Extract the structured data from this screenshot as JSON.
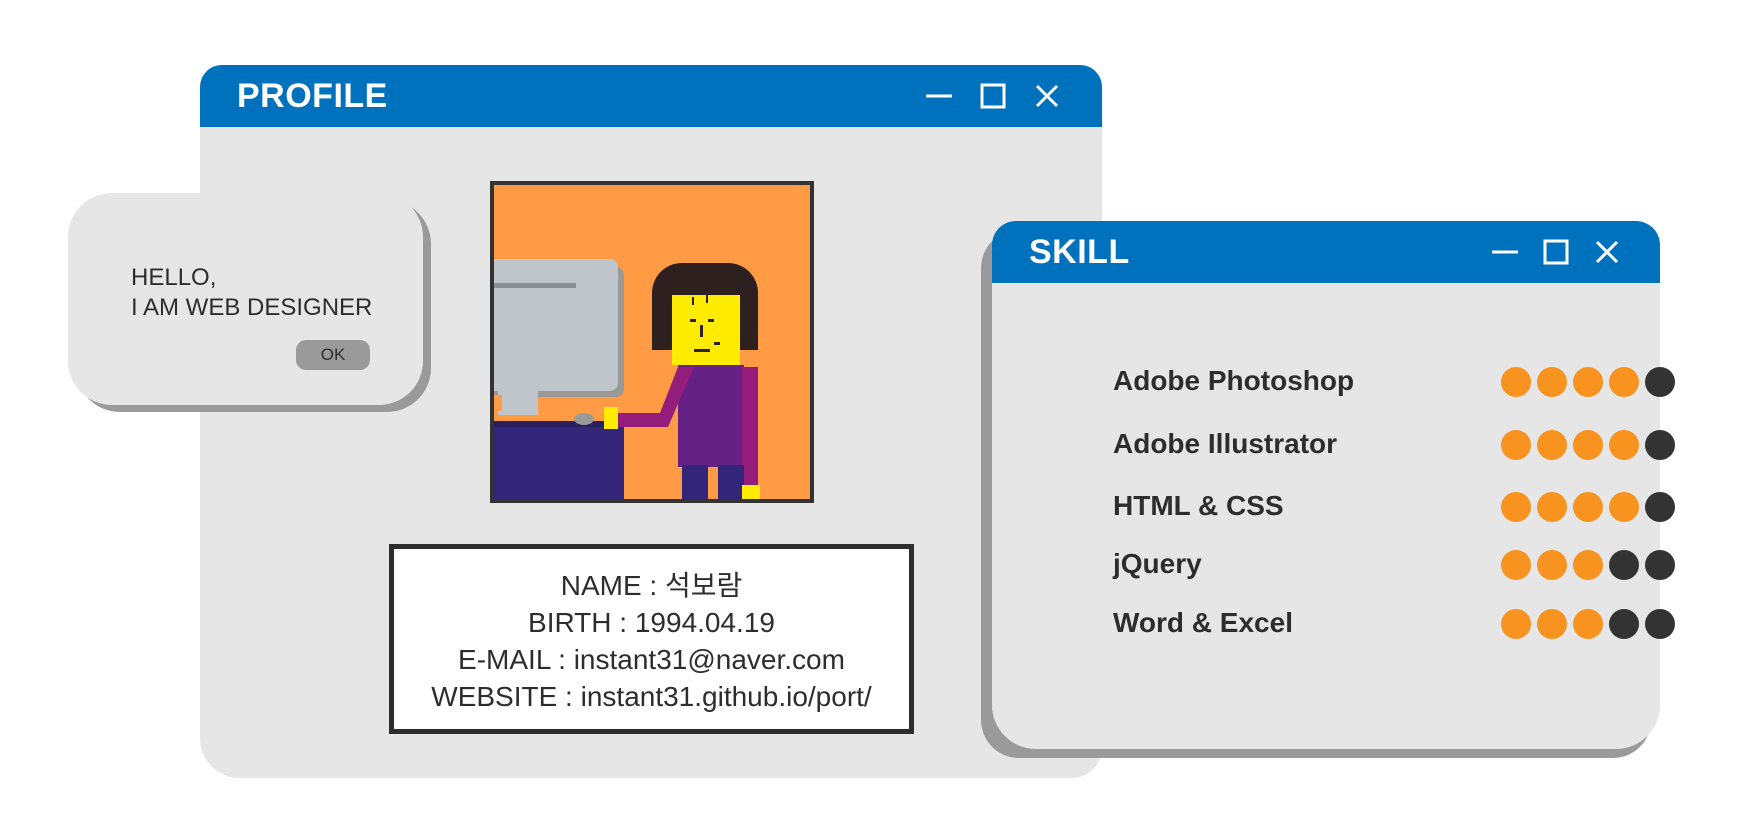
{
  "profile": {
    "title": "PROFILE",
    "info": {
      "name": "NAME : 석보람",
      "birth": "BIRTH : 1994.04.19",
      "email": "E-MAIL : instant31@naver.com",
      "website": "WEBSITE : instant31.github.io/port/"
    }
  },
  "dialog": {
    "line1": "HELLO,",
    "line2": "I AM WEB DESIGNER",
    "ok_label": "OK"
  },
  "skill": {
    "title": "SKILL",
    "items": [
      {
        "label": "Adobe Photoshop",
        "level": 4,
        "max": 5
      },
      {
        "label": "Adobe Illustrator",
        "level": 4,
        "max": 5
      },
      {
        "label": "HTML & CSS",
        "level": 4,
        "max": 5
      },
      {
        "label": "jQuery",
        "level": 3,
        "max": 5
      },
      {
        "label": "Word & Excel",
        "level": 3,
        "max": 5
      }
    ]
  },
  "icons": {
    "minimize": "minimize-icon",
    "maximize": "maximize-icon",
    "close": "close-icon"
  },
  "colors": {
    "titlebar": "#0071bd",
    "window_bg": "#e6e6e7",
    "dot_filled": "#f7931e",
    "dot_empty": "#333333"
  }
}
